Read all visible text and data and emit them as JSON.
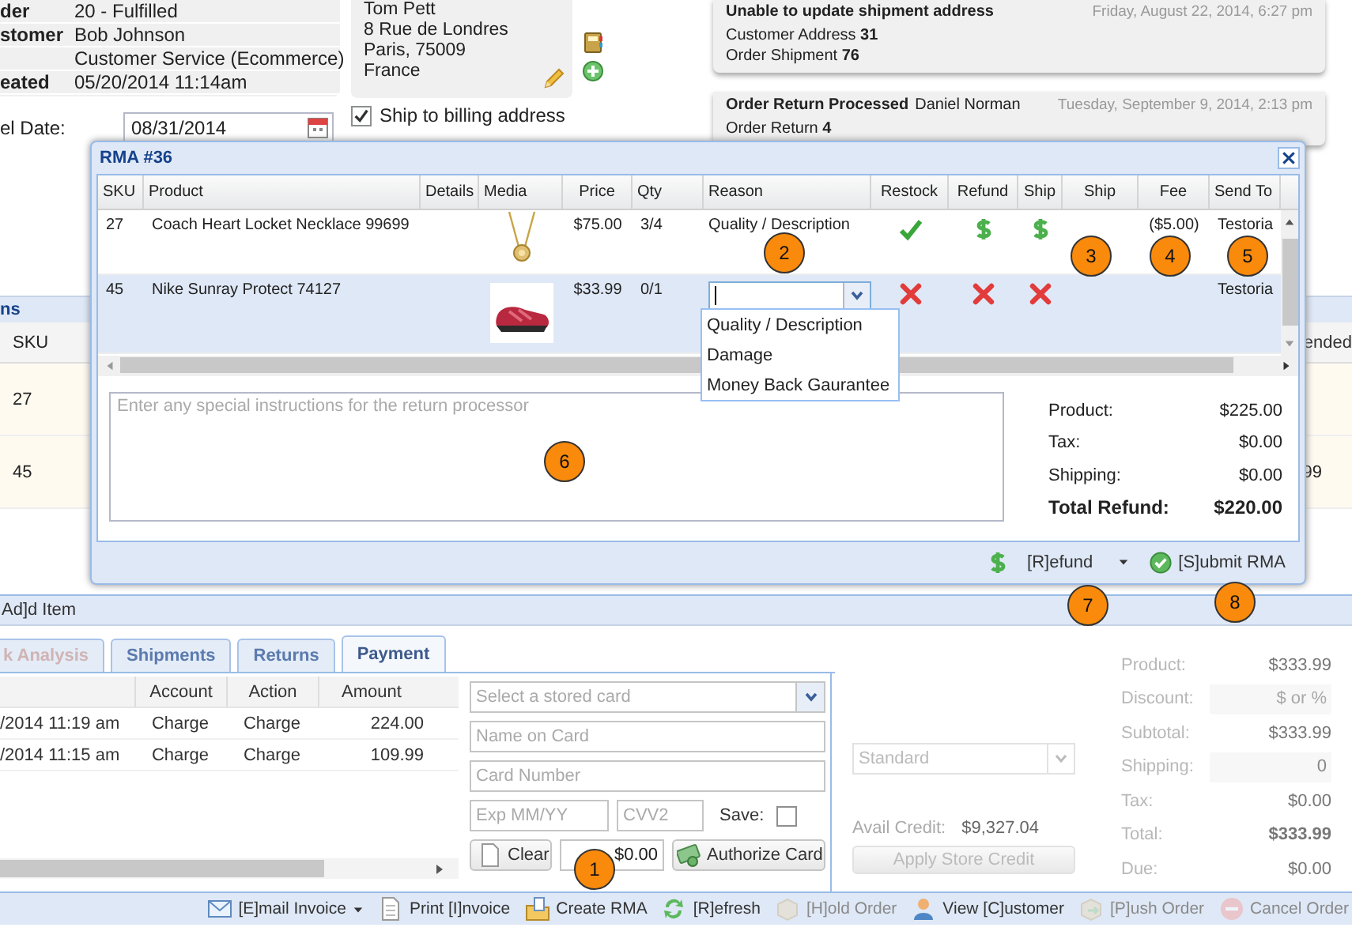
{
  "order_info": {
    "rows": [
      {
        "label": "der",
        "value": "20 - Fulfilled"
      },
      {
        "label": "stomer",
        "value": "Bob Johnson"
      },
      {
        "value": "Customer Service (Ecommerce)"
      },
      {
        "label": "eated",
        "value": "05/20/2014 11:14am"
      }
    ]
  },
  "cancel_date": {
    "label": "el Date:",
    "value": "08/31/2014"
  },
  "address": {
    "lines": [
      "Tom Pett",
      "8 Rue de Londres",
      "Paris, 75009",
      "France"
    ]
  },
  "ship_to_billing": {
    "label": "Ship to billing address",
    "checked": true
  },
  "notifications": [
    {
      "title": "Unable to update shipment address",
      "date": "Friday, August 22, 2014, 6:27 pm",
      "details": [
        "Customer Address **31**",
        "Order Shipment **76**"
      ]
    },
    {
      "title": "Order Return Processed",
      "author": "Daniel Norman",
      "date": "Tuesday, September 9, 2014, 2:13 pm",
      "details": [
        "Order Return **4**"
      ]
    }
  ],
  "items_panel": {
    "title": "ns",
    "first_column": "SKU",
    "last_column": "ended",
    "rows": [
      {
        "sku": "27"
      },
      {
        "sku": "45",
        "last": "99"
      }
    ]
  },
  "add_item": "Ad]d Item",
  "tabs": [
    {
      "label": "k Analysis",
      "selected": false,
      "disabled": true
    },
    {
      "label": "Shipments",
      "selected": false,
      "disabled": false
    },
    {
      "label": "Returns",
      "selected": false,
      "disabled": false
    },
    {
      "label": "Payment",
      "selected": true,
      "disabled": false
    }
  ],
  "payments": {
    "columns": [
      "Account",
      "Action",
      "Amount"
    ],
    "rows": [
      {
        "date": "/2014 11:19 am",
        "account": "Charge",
        "action": "Charge",
        "amount": "224.00"
      },
      {
        "date": "/2014 11:15 am",
        "account": "Charge",
        "action": "Charge",
        "amount": "109.99"
      }
    ]
  },
  "card_form": {
    "stored_card_placeholder": "Select a stored card",
    "name_placeholder": "Name on Card",
    "number_placeholder": "Card Number",
    "exp_placeholder": "Exp MM/YY",
    "cvv_placeholder": "CVV2",
    "save_label": "Save:",
    "save_checked": false,
    "clear_button": "Clear",
    "amount": "$0.00",
    "authorize_button": "Authorize Card"
  },
  "shipping_method": {
    "value": "Standard"
  },
  "store_credit": {
    "label": "Avail Credit:",
    "value": "$9,327.04",
    "button": "Apply Store Credit"
  },
  "summary": {
    "disabled": true,
    "rows": [
      {
        "kind": "text",
        "label": "Product:",
        "value": "$333.99"
      },
      {
        "kind": "field",
        "label": "Discount:",
        "placeholder": "$ or %"
      },
      {
        "kind": "text",
        "label": "Subtotal:",
        "value": "$333.99"
      },
      {
        "kind": "field",
        "label": "Shipping:",
        "value": "0"
      },
      {
        "kind": "text",
        "label": "Tax:",
        "value": "$0.00"
      },
      {
        "kind": "total",
        "label": "Total:",
        "value": "$333.99"
      },
      {
        "kind": "text",
        "label": "Due:",
        "value": "$0.00"
      }
    ]
  },
  "toolbar": [
    {
      "label": "[E]mail Invoice",
      "has_menu": true,
      "disabled": false
    },
    {
      "label": "Print [I]nvoice",
      "has_menu": false,
      "disabled": false
    },
    {
      "label": "Create RMA",
      "has_menu": false,
      "disabled": false
    },
    {
      "label": "[R]efresh",
      "has_menu": false,
      "disabled": false
    },
    {
      "label": "[H]old Order",
      "has_menu": false,
      "disabled": true
    },
    {
      "label": "View [C]ustomer",
      "has_menu": false,
      "disabled": false
    },
    {
      "label": "[P]ush Order",
      "has_menu": false,
      "disabled": true
    },
    {
      "label": "Cancel Order",
      "has_menu": false,
      "disabled": true
    }
  ],
  "rma": {
    "title": "RMA #36",
    "columns": [
      "SKU",
      "Product",
      "Details",
      "Media",
      "Price",
      "Qty",
      "Reason",
      "Restock",
      "Refund",
      "Ship",
      "Ship",
      "Fee",
      "Send To"
    ],
    "rows": [
      {
        "sku": "27",
        "product": "Coach Heart Locket Necklace 99699",
        "price": "$75.00",
        "qty": "3/4",
        "reason": "Quality / Description",
        "editing": false,
        "restock": true,
        "refund": true,
        "ship": true,
        "fee": "($5.00)",
        "send_to": "Testoria",
        "selected": false
      },
      {
        "sku": "45",
        "product": "Nike Sunray Protect 74127",
        "price": "$33.99",
        "qty": "0/1",
        "editing": true,
        "restock": false,
        "refund": false,
        "ship": false,
        "send_to": "Testoria",
        "selected": true
      }
    ],
    "reason_options": [
      "Quality / Description",
      "Damage",
      "Money Back Gaurantee"
    ],
    "instructions_placeholder": "Enter any special instructions for the return processor",
    "totals": [
      {
        "kind": "normal",
        "label": "Product:",
        "value": "$225.00"
      },
      {
        "kind": "normal",
        "label": "Tax:",
        "value": "$0.00"
      },
      {
        "kind": "normal",
        "label": "Shipping:",
        "value": "$0.00"
      },
      {
        "kind": "total",
        "label": "Total Refund:",
        "value": "$220.00"
      }
    ],
    "refund_button": "[R]efund",
    "submit_button": "[S]ubmit RMA"
  },
  "callouts": [
    "1",
    "2",
    "3",
    "4",
    "5",
    "6",
    "7",
    "8"
  ]
}
